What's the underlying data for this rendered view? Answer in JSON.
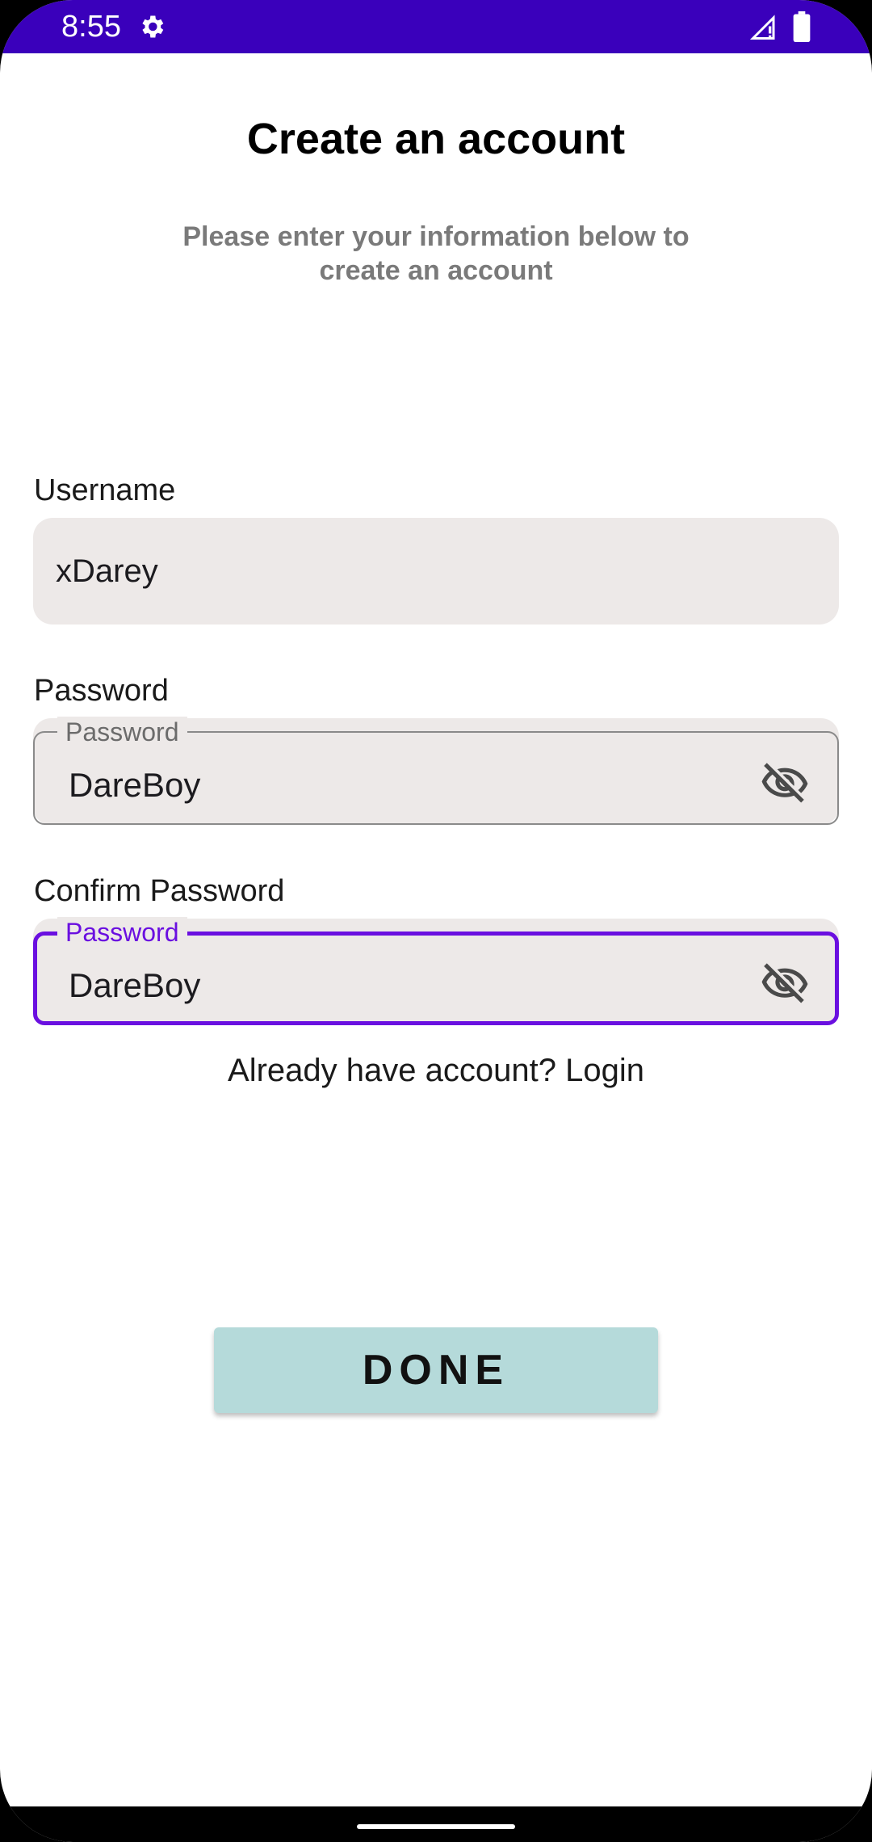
{
  "status_bar": {
    "time": "8:55",
    "icons": [
      "gear-icon",
      "signal-icon",
      "battery-icon"
    ],
    "background_color": "#3a00bb"
  },
  "header": {
    "title": "Create an account",
    "subtitle": "Please enter your information below to create an account"
  },
  "form": {
    "username": {
      "label": "Username",
      "value": "xDarey"
    },
    "password": {
      "label": "Password",
      "floating_label": "Password",
      "value": "DareBoy",
      "icon": "eye-off-icon"
    },
    "confirm_password": {
      "label": "Confirm Password",
      "floating_label": "Password",
      "value": "DareBoy",
      "icon": "eye-off-icon",
      "focused_color": "#6a0fe0"
    }
  },
  "login_prompt": "Already have account? Login",
  "done_button": {
    "label": "DONE",
    "color": "#b5dada"
  }
}
